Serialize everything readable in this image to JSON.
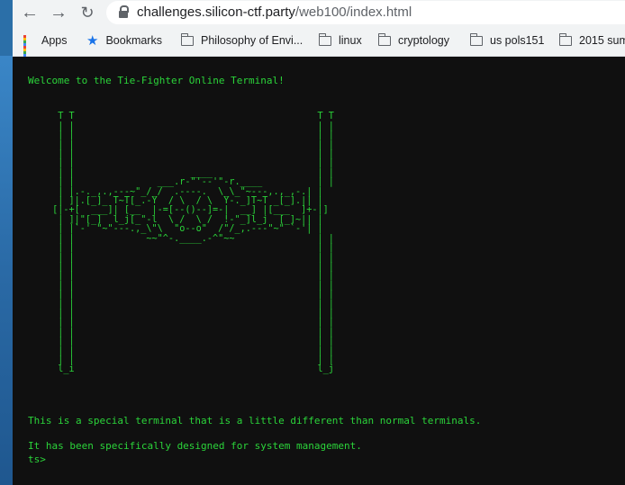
{
  "browser": {
    "back_icon": "←",
    "forward_icon": "→",
    "reload_icon": "↻",
    "url_host": "challenges.silicon-ctf.party",
    "url_path": "/web100/index.html"
  },
  "bookmarks": [
    {
      "label": "Apps",
      "icon": "apps-grid-icon"
    },
    {
      "label": "Bookmarks",
      "icon": "star-icon"
    },
    {
      "label": "Philosophy of Envi...",
      "icon": "folder-icon"
    },
    {
      "label": "linux",
      "icon": "folder-icon"
    },
    {
      "label": "cryptology",
      "icon": "folder-icon"
    },
    {
      "label": "us pols151",
      "icon": "folder-icon"
    },
    {
      "label": "2015 sum",
      "icon": "folder-icon"
    }
  ],
  "terminal": {
    "welcome": "Welcome to the Tie-Fighter Online Terminal!",
    "art": "  _                                              _\n  T T                                            T T\n  | |                                            | |\n  | |                                            | |\n  | |                                            | |\n  | |                                            | |\n  | |                                            | |\n  | |                     ____                   | |\n  | |               ___.r-\"'--'\"-r.____          | |\n  | |.-._,.,---~\"_/_/  .----.  \\_\\_\"~---,.,_,-.| |\n  | ]|.[_]_ T~T[_.-Y  / \\  / \\  Y-._]T~T _[_].|| |\n [|-+[  ___]| [__  |-=[--()--]=-|  __] |[___  ]+-|]\n  | ]|\"[_]  l_j[_\"-l  \\ /  \\ /  !-\"_]l_j  [_]~|| |\n  | |`-' \"~\"---.,_\\\"\\  \"o--o\"  /\"/_,.---\"~\" `-'| |\n  | |             ~~\"^-.____.-^\"~~               | |\n  | |                                            | |\n  | |                                            | |\n  | |                                            | |\n  | |                                            | |\n  | |                                            | |\n  | |                                            | |\n  | |                                            | |\n  | |                                            | |\n  | |                                            | |\n  | |                                            | |\n  | |                                            | |\n  | |                                            | |\n  | |                                            | |\n  l_i                                            l_j",
    "info1": "This is a special terminal that is a little different than normal terminals.",
    "info2": "It has been specifically designed for system management.",
    "prompt": "ts>"
  },
  "colors": {
    "terminal_bg": "#101010",
    "terminal_text": "#2bd43a",
    "chrome_bg": "#f1f3f4"
  }
}
